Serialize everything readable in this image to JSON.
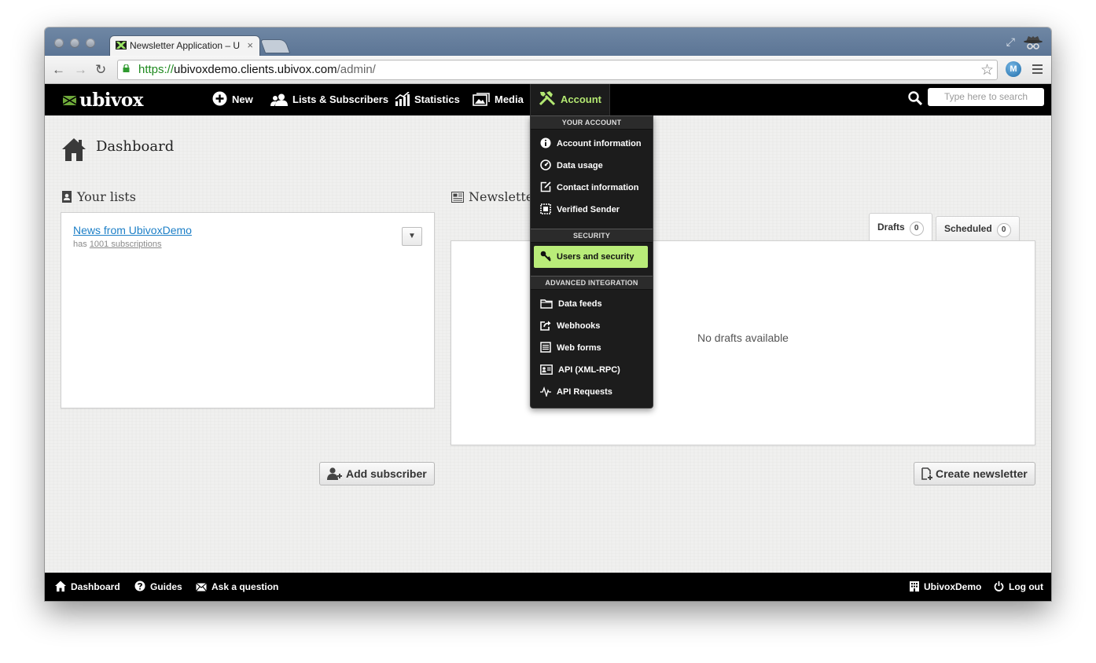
{
  "browser": {
    "tab_title": "Newsletter Application – Ubivox",
    "tab_close": "×",
    "url_scheme": "https://",
    "url_host": "ubivoxdemo.clients.ubivox.com",
    "url_path": "/admin/",
    "extension_label": "M"
  },
  "appnav": {
    "logo_text": "ubivox",
    "items": [
      {
        "label": "New",
        "icon": "plus-circle-icon"
      },
      {
        "label": "Lists & Subscribers",
        "icon": "users-icon"
      },
      {
        "label": "Statistics",
        "icon": "chart-icon"
      },
      {
        "label": "Media",
        "icon": "images-icon"
      },
      {
        "label": "Account",
        "icon": "tools-icon"
      }
    ],
    "search_placeholder": "Type here to search"
  },
  "page": {
    "title": "Dashboard",
    "lists_title": "Your lists",
    "newsletters_title": "Newsletters"
  },
  "lists": {
    "items": [
      {
        "name": "News from UbivoxDemo",
        "prefix": "has",
        "count_text": "1001 subscriptions",
        "menu_glyph": "▼"
      }
    ],
    "add_button": "Add subscriber"
  },
  "newsletters": {
    "tabs": [
      {
        "label": "Drafts",
        "count": "0",
        "active": true
      },
      {
        "label": "Scheduled",
        "count": "0",
        "active": false
      }
    ],
    "empty_text": "No drafts available",
    "create_button": "Create newsletter"
  },
  "account_menu": {
    "section_account": "YOUR ACCOUNT",
    "account_items": [
      {
        "label": "Account information",
        "icon": "info-icon"
      },
      {
        "label": "Data usage",
        "icon": "gauge-icon"
      },
      {
        "label": "Contact information",
        "icon": "edit-icon"
      },
      {
        "label": "Verified Sender",
        "icon": "stamp-icon"
      }
    ],
    "section_security": "SECURITY",
    "security_items": [
      {
        "label": "Users and security",
        "icon": "key-icon",
        "highlighted": true
      }
    ],
    "section_integration": "ADVANCED INTEGRATION",
    "integration_items": [
      {
        "label": "Data feeds",
        "icon": "folder-icon"
      },
      {
        "label": "Webhooks",
        "icon": "share-icon"
      },
      {
        "label": "Web forms",
        "icon": "form-icon"
      },
      {
        "label": "API (XML-RPC)",
        "icon": "id-card-icon"
      },
      {
        "label": "API Requests",
        "icon": "pulse-icon"
      }
    ],
    "highlight_color": "#b9ec79"
  },
  "footer": {
    "left": [
      {
        "label": "Dashboard",
        "icon": "home-icon"
      },
      {
        "label": "Guides",
        "icon": "help-icon"
      },
      {
        "label": "Ask a question",
        "icon": "envelope-icon"
      }
    ],
    "right": [
      {
        "label": "UbivoxDemo",
        "icon": "building-icon"
      },
      {
        "label": "Log out",
        "icon": "power-icon"
      }
    ]
  },
  "colors": {
    "accent": "#b3e872",
    "link": "#1c7fc7",
    "nav_bg": "#000000"
  }
}
